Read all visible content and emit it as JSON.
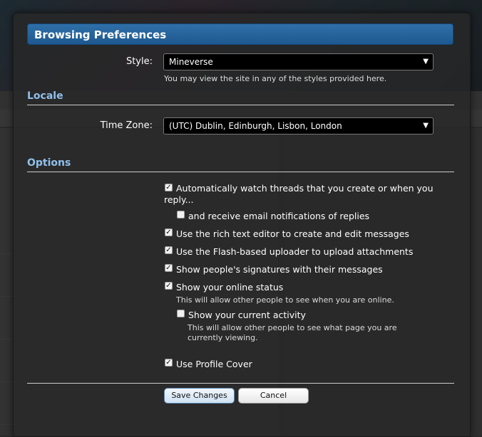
{
  "dialog": {
    "title": "Browsing Preferences"
  },
  "style": {
    "label": "Style:",
    "value": "Mineverse",
    "hint": "You may view the site in any of the styles provided here."
  },
  "locale": {
    "heading": "Locale",
    "timezone_label": "Time Zone:",
    "timezone_value": "(UTC) Dublin, Edinburgh, Lisbon, London"
  },
  "options": {
    "heading": "Options",
    "items": [
      {
        "label": "Automatically watch threads that you create or when you reply...",
        "checked": true
      },
      {
        "label": "and receive email notifications of replies",
        "checked": false
      },
      {
        "label": "Use the rich text editor to create and edit messages",
        "checked": true
      },
      {
        "label": "Use the Flash-based uploader to upload attachments",
        "checked": true
      },
      {
        "label": "Show people's signatures with their messages",
        "checked": true
      },
      {
        "label": "Show your online status",
        "checked": true,
        "hint": "This will allow other people to see when you are online."
      },
      {
        "label": "Show your current activity",
        "checked": false,
        "hint": "This will allow other people to see what page you are currently viewing."
      },
      {
        "label": "Use Profile Cover",
        "checked": true
      }
    ]
  },
  "buttons": {
    "save": "Save Changes",
    "cancel": "Cancel"
  },
  "colors": {
    "title_bar": "#1e5990",
    "section_heading": "#8fc0ec",
    "panel": "#282828"
  },
  "icons": {
    "dropdown": "chevron-down-icon",
    "checkbox": "checkmark-icon"
  }
}
